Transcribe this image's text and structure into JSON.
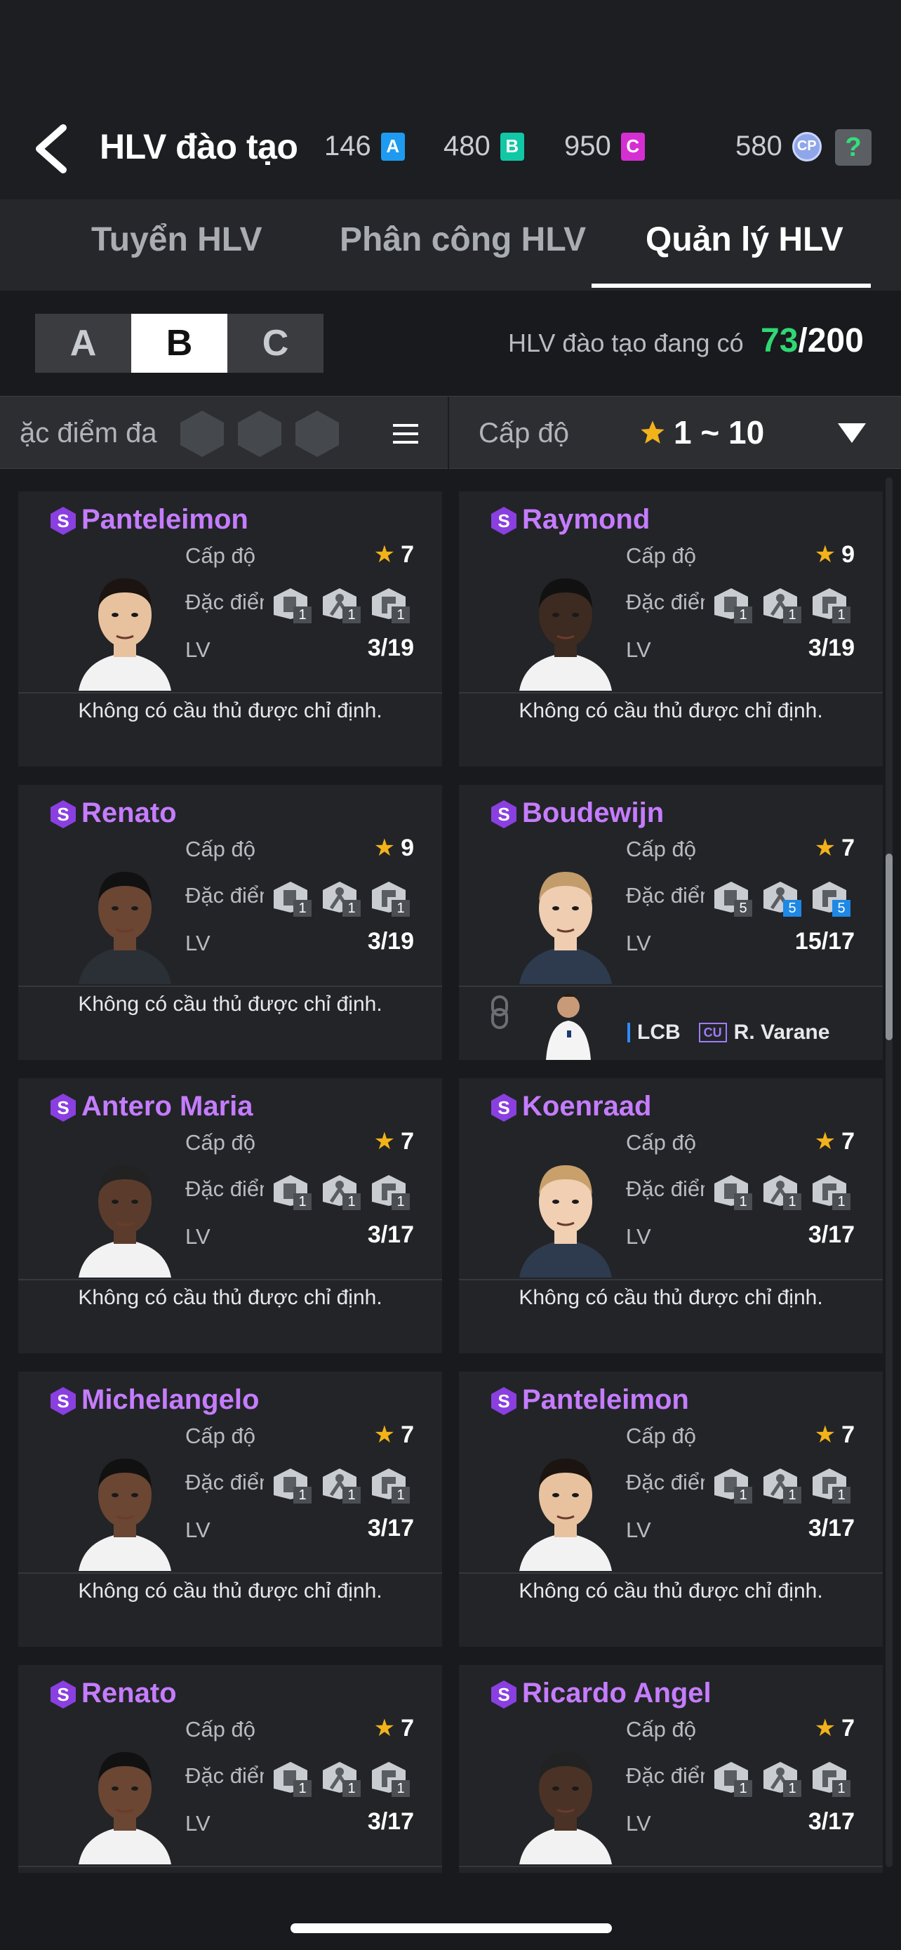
{
  "header": {
    "title": "HLV đào tạo",
    "currencies": [
      {
        "amount": "146",
        "label": "A",
        "color": "#1e9bf0"
      },
      {
        "amount": "480",
        "label": "B",
        "color": "#12c7a5"
      },
      {
        "amount": "950",
        "label": "C",
        "color": "#d52fd2"
      },
      {
        "amount": "580",
        "label": "CP",
        "color": "#8fa6e8"
      }
    ],
    "help_label": "?"
  },
  "tabs": [
    {
      "label": "Tuyển HLV",
      "active": false
    },
    {
      "label": "Phân công  HLV",
      "active": false
    },
    {
      "label": "Quản lý HLV",
      "active": true
    }
  ],
  "grades": [
    {
      "label": "A",
      "active": false
    },
    {
      "label": "B",
      "active": true
    },
    {
      "label": "C",
      "active": false
    }
  ],
  "coach_count": {
    "label": "HLV đào tạo đang có",
    "current": "73",
    "max": "/200"
  },
  "filter": {
    "trait_label": "ặc điểm đa",
    "level_label": "Cấp độ",
    "level_range": "1 ~ 10"
  },
  "labels": {
    "level": "Cấp độ",
    "trait": "Đặc điểm",
    "trait_clipped": "Đặc điểm",
    "lv": "LV",
    "no_player": "Không có cầu thủ được chỉ định."
  },
  "cards": [
    {
      "name": "Panteleimon",
      "stars": "7",
      "lv": "3/19",
      "trait_nums": [
        "1",
        "1",
        "1"
      ],
      "trait_blue": [
        false,
        false,
        false
      ],
      "assigned": null
    },
    {
      "name": "Raymond",
      "stars": "9",
      "lv": "3/19",
      "trait_nums": [
        "1",
        "1",
        "1"
      ],
      "trait_blue": [
        false,
        false,
        false
      ],
      "assigned": null
    },
    {
      "name": "Renato",
      "stars": "9",
      "lv": "3/19",
      "trait_nums": [
        "1",
        "1",
        "1"
      ],
      "trait_blue": [
        false,
        false,
        false
      ],
      "assigned": null
    },
    {
      "name": "Boudewijn",
      "stars": "7",
      "lv": "15/17",
      "trait_nums": [
        "5",
        "5",
        "5"
      ],
      "trait_blue": [
        false,
        true,
        true
      ],
      "assigned": {
        "position": "LCB",
        "badge": "CU",
        "player": "R. Varane"
      }
    },
    {
      "name": "Antero Maria",
      "stars": "7",
      "lv": "3/17",
      "trait_nums": [
        "1",
        "1",
        "1"
      ],
      "trait_blue": [
        false,
        false,
        false
      ],
      "assigned": null
    },
    {
      "name": "Koenraad",
      "stars": "7",
      "lv": "3/17",
      "trait_nums": [
        "1",
        "1",
        "1"
      ],
      "trait_blue": [
        false,
        false,
        false
      ],
      "assigned": null
    },
    {
      "name": "Michelangelo",
      "stars": "7",
      "lv": "3/17",
      "trait_nums": [
        "1",
        "1",
        "1"
      ],
      "trait_blue": [
        false,
        false,
        false
      ],
      "assigned": null
    },
    {
      "name": "Panteleimon",
      "stars": "7",
      "lv": "3/17",
      "trait_nums": [
        "1",
        "1",
        "1"
      ],
      "trait_blue": [
        false,
        false,
        false
      ],
      "assigned": null
    },
    {
      "name": "Renato",
      "stars": "7",
      "lv": "3/17",
      "trait_nums": [
        "1",
        "1",
        "1"
      ],
      "trait_blue": [
        false,
        false,
        false
      ],
      "assigned": null
    },
    {
      "name": "Ricardo Angel",
      "stars": "7",
      "lv": "3/17",
      "trait_nums": [
        "1",
        "1",
        "1"
      ],
      "trait_blue": [
        false,
        false,
        false
      ],
      "assigned": null
    }
  ],
  "colors": {
    "background": "#181a1d",
    "card": "#222427",
    "name_purple": "#c57cff",
    "star": "#f2b21a",
    "count_green": "#2fd873"
  }
}
